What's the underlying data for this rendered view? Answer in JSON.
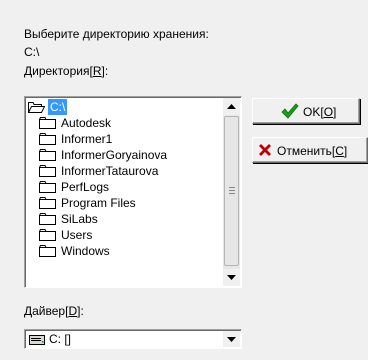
{
  "prompt": "Выберите директорию хранения:",
  "current_path": "C:\\",
  "directory_label": {
    "text": "Директория",
    "hotkey": "R"
  },
  "directories": [
    {
      "name": "C:\\",
      "level": 0,
      "selected": true,
      "icon": "open-folder-icon"
    },
    {
      "name": "Autodesk",
      "level": 1,
      "icon": "folder-icon"
    },
    {
      "name": "Informer1",
      "level": 1,
      "icon": "folder-icon"
    },
    {
      "name": "InformerGoryainova",
      "level": 1,
      "icon": "folder-icon"
    },
    {
      "name": "InformerTataurova",
      "level": 1,
      "icon": "folder-icon"
    },
    {
      "name": "PerfLogs",
      "level": 1,
      "icon": "folder-icon"
    },
    {
      "name": "Program Files",
      "level": 1,
      "icon": "folder-icon"
    },
    {
      "name": "SiLabs",
      "level": 1,
      "icon": "folder-icon"
    },
    {
      "name": "Users",
      "level": 1,
      "icon": "folder-icon"
    },
    {
      "name": "Windows",
      "level": 1,
      "icon": "folder-icon"
    }
  ],
  "buttons": {
    "ok": {
      "text": "OK",
      "hotkey": "O",
      "icon": "checkmark-icon",
      "icon_color": "#1a9e1a"
    },
    "cancel": {
      "text": "Отменить",
      "hotkey": "C",
      "icon": "x-icon",
      "icon_color": "#c00000"
    }
  },
  "drive_label": {
    "text": "Дайвер",
    "hotkey": "D"
  },
  "drive": {
    "value": "C: []",
    "icon": "drive-icon"
  },
  "colors": {
    "selection": "#3399ff",
    "window_bg": "#f0f0f0"
  }
}
